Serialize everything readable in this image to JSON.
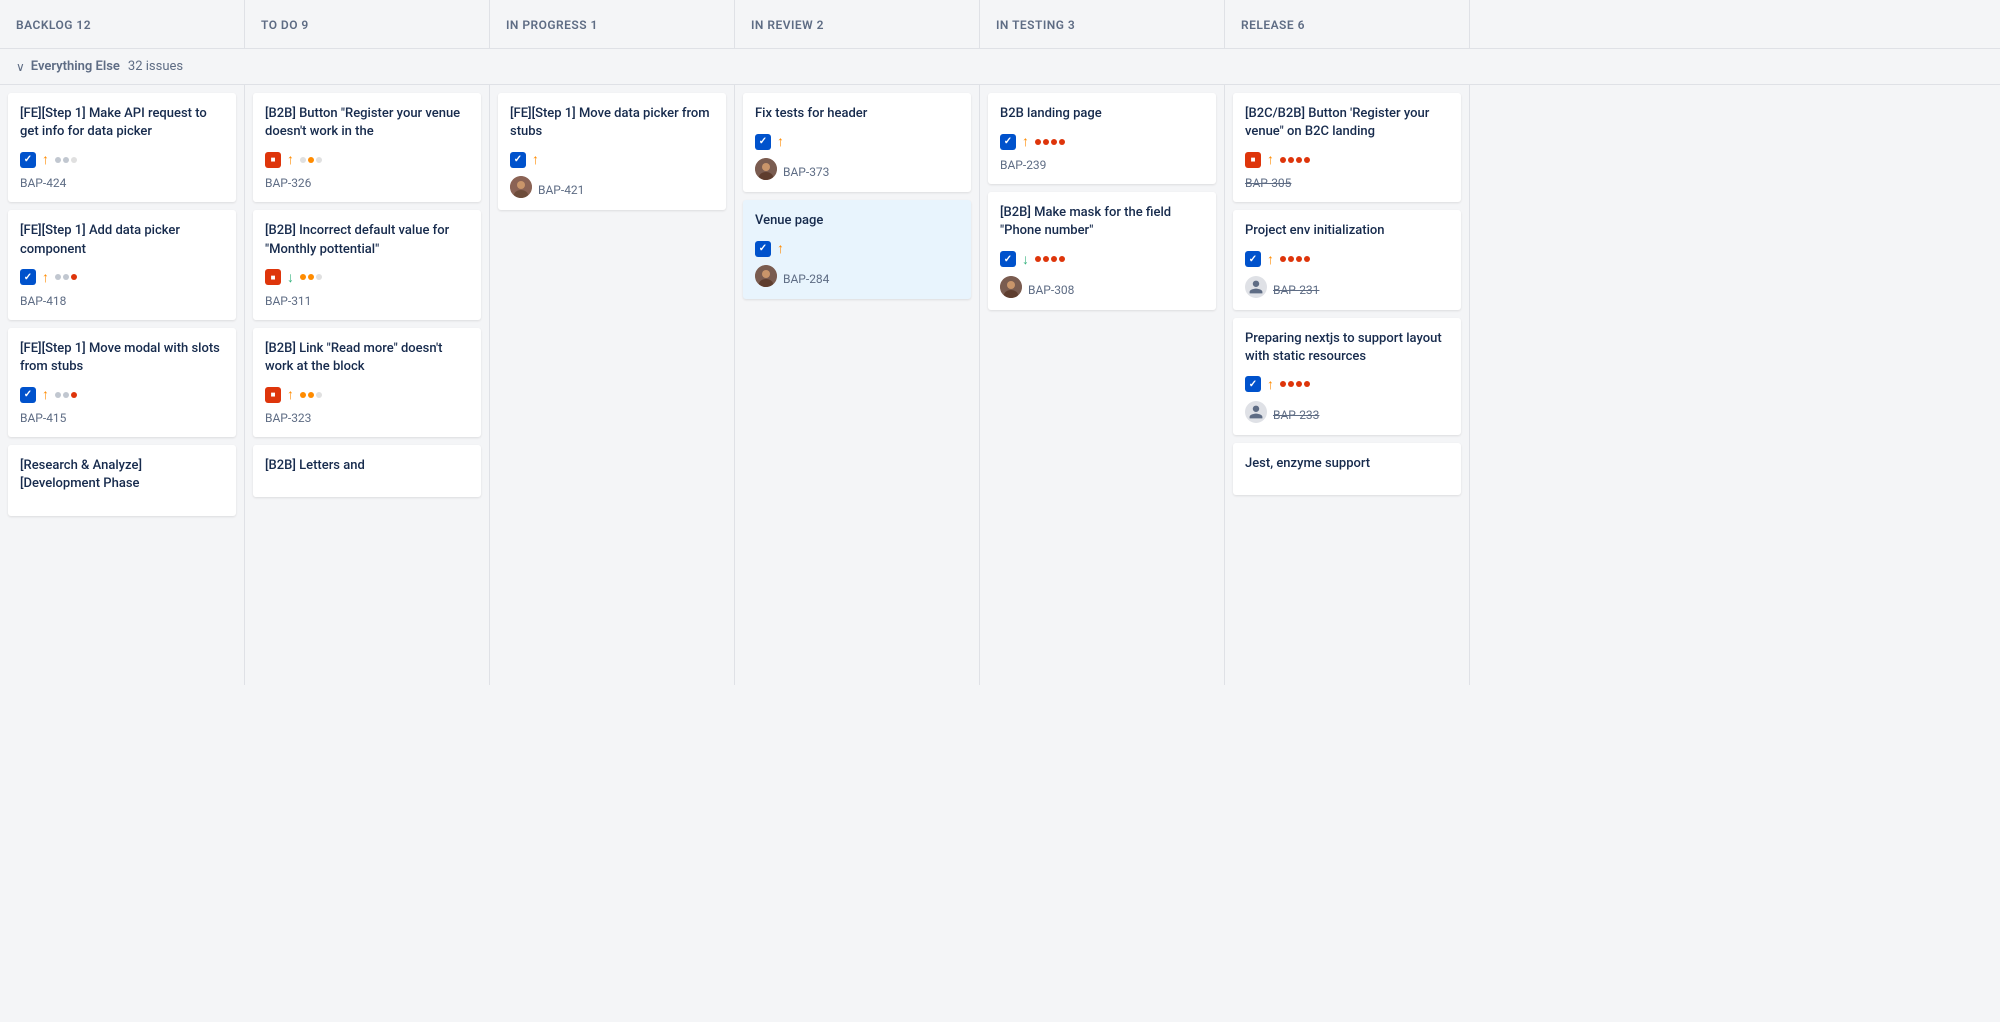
{
  "columns": [
    {
      "id": "backlog",
      "header": "BACKLOG 12"
    },
    {
      "id": "todo",
      "header": "TO DO 9"
    },
    {
      "id": "inprogress",
      "header": "IN PROGRESS 1"
    },
    {
      "id": "inreview",
      "header": "IN REVIEW 2"
    },
    {
      "id": "intesting",
      "header": "IN TESTING 3"
    },
    {
      "id": "release",
      "header": "RELEASE 6"
    }
  ],
  "group": {
    "chevron": "∨",
    "label": "Everything Else",
    "count": "32 issues"
  },
  "cards": {
    "backlog": [
      {
        "id": "bap-424",
        "title": "[FE][Step 1] Make API request to get info for data picker",
        "ticket": "BAP-424",
        "iconType": "checkbox",
        "priority": "up",
        "dots": [
          "gray",
          "gray",
          "empty"
        ],
        "hasAvatar": false,
        "strikethrough": false,
        "highlighted": false
      },
      {
        "id": "bap-418",
        "title": "[FE][Step 1] Add data picker component",
        "ticket": "BAP-418",
        "iconType": "checkbox",
        "priority": "up",
        "dots": [
          "gray",
          "gray",
          "red"
        ],
        "hasAvatar": false,
        "strikethrough": false,
        "highlighted": false
      },
      {
        "id": "bap-415",
        "title": "[FE][Step 1] Move modal with slots from stubs",
        "ticket": "BAP-415",
        "iconType": "checkbox",
        "priority": "up",
        "dots": [
          "gray",
          "gray",
          "red"
        ],
        "hasAvatar": false,
        "strikethrough": false,
        "highlighted": false
      },
      {
        "id": "bap-dev",
        "title": "[Research & Analyze] [Development Phase",
        "ticket": "",
        "iconType": "checkbox",
        "priority": "up",
        "dots": [
          "gray",
          "gray",
          "empty"
        ],
        "hasAvatar": false,
        "strikethrough": false,
        "highlighted": false
      }
    ],
    "todo": [
      {
        "id": "bap-326",
        "title": "[B2B] Button \"Register your venue doesn't work in the",
        "ticket": "BAP-326",
        "iconType": "stop",
        "priority": "up",
        "dots": [
          "gray",
          "orange",
          "empty"
        ],
        "hasAvatar": false,
        "strikethrough": false,
        "highlighted": false
      },
      {
        "id": "bap-311",
        "title": "[B2B] Incorrect default value for \"Monthly pottential\"",
        "ticket": "BAP-311",
        "iconType": "stop",
        "priority": "down",
        "dots": [
          "orange",
          "orange",
          "empty"
        ],
        "hasAvatar": false,
        "strikethrough": false,
        "highlighted": false
      },
      {
        "id": "bap-323",
        "title": "[B2B] Link \"Read more\" doesn't work at the block",
        "ticket": "BAP-323",
        "iconType": "stop",
        "priority": "up",
        "dots": [
          "orange",
          "orange",
          "empty"
        ],
        "hasAvatar": false,
        "strikethrough": false,
        "highlighted": false
      },
      {
        "id": "bap-b2b",
        "title": "[B2B] Letters and",
        "ticket": "",
        "iconType": "stop",
        "priority": "up",
        "dots": [
          "gray",
          "gray",
          "empty"
        ],
        "hasAvatar": false,
        "strikethrough": false,
        "highlighted": false
      }
    ],
    "inprogress": [
      {
        "id": "bap-421",
        "title": "[FE][Step 1] Move data picker from stubs",
        "ticket": "BAP-421",
        "iconType": "checkbox",
        "priority": "up",
        "dots": [],
        "hasAvatar": true,
        "strikethrough": false,
        "highlighted": false
      }
    ],
    "inreview": [
      {
        "id": "bap-373",
        "title": "Fix tests for header",
        "ticket": "BAP-373",
        "iconType": "checkbox",
        "priority": "up",
        "dots": [],
        "hasAvatar": true,
        "strikethrough": false,
        "highlighted": false
      },
      {
        "id": "bap-284",
        "title": "Venue page",
        "ticket": "BAP-284",
        "iconType": "checkbox",
        "priority": "up",
        "dots": [],
        "hasAvatar": true,
        "strikethrough": false,
        "highlighted": true
      }
    ],
    "intesting": [
      {
        "id": "bap-239",
        "title": "B2B landing page",
        "ticket": "BAP-239",
        "iconType": "checkbox",
        "priority": "up",
        "dots": [
          "red",
          "red",
          "red",
          "red"
        ],
        "hasAvatar": false,
        "strikethrough": false,
        "highlighted": false
      },
      {
        "id": "bap-308",
        "title": "[B2B] Make mask for the field \"Phone number\"",
        "ticket": "BAP-308",
        "iconType": "checkbox",
        "priority": "down",
        "dots": [
          "red",
          "red",
          "red",
          "red"
        ],
        "hasAvatar": true,
        "strikethrough": false,
        "highlighted": false
      }
    ],
    "release": [
      {
        "id": "bap-305",
        "title": "[B2C/B2B] Button 'Register your venue\" on B2C landing",
        "ticket": "BAP-305",
        "iconType": "stop",
        "priority": "up",
        "dots": [
          "red",
          "red",
          "red",
          "red"
        ],
        "hasAvatar": false,
        "strikethrough": true,
        "highlighted": false
      },
      {
        "id": "bap-231",
        "title": "Project env initialization",
        "ticket": "BAP-231",
        "iconType": "checkbox",
        "priority": "up",
        "dots": [
          "red",
          "red",
          "red",
          "red"
        ],
        "hasAvatar": true,
        "avatarType": "user-placeholder",
        "strikethrough": true,
        "highlighted": false
      },
      {
        "id": "bap-233",
        "title": "Preparing nextjs to support layout with static resources",
        "ticket": "BAP-233",
        "iconType": "checkbox",
        "priority": "up",
        "dots": [
          "red",
          "red",
          "red",
          "red"
        ],
        "hasAvatar": true,
        "avatarType": "user-placeholder",
        "strikethrough": true,
        "highlighted": false
      },
      {
        "id": "bap-jest",
        "title": "Jest, enzyme support",
        "ticket": "",
        "iconType": "checkbox",
        "priority": "up",
        "dots": [],
        "hasAvatar": false,
        "strikethrough": false,
        "highlighted": false
      }
    ]
  }
}
